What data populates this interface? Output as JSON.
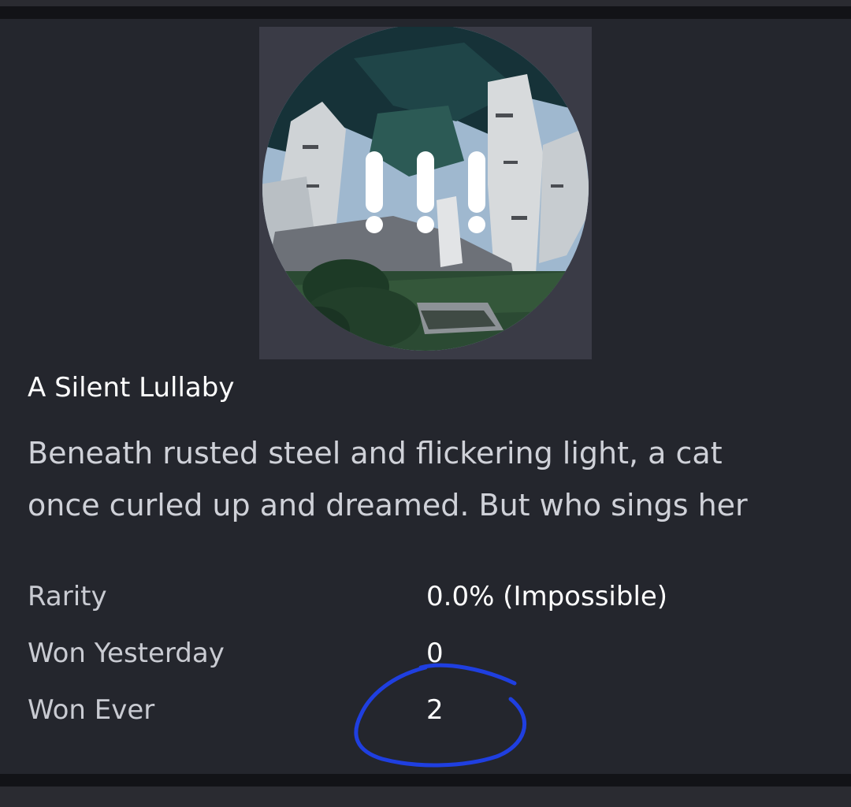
{
  "badge": {
    "name": "A Silent Lullaby",
    "description_lines": [
      "Beneath rusted steel and flickering light, a cat",
      "once curled up and dreamed. But who sings her"
    ],
    "thumbnail_icon": "exclamation-marks-scene"
  },
  "stats": [
    {
      "label": "Rarity",
      "value": "0.0% (Impossible)"
    },
    {
      "label": "Won Yesterday",
      "value": "0"
    },
    {
      "label": "Won Ever",
      "value": "2"
    }
  ],
  "colors": {
    "card_bg": "#24262d",
    "page_bg": "#121317",
    "annotation": "#1f3fe0",
    "text_primary": "#ffffff",
    "text_secondary": "#c9cbd2"
  }
}
